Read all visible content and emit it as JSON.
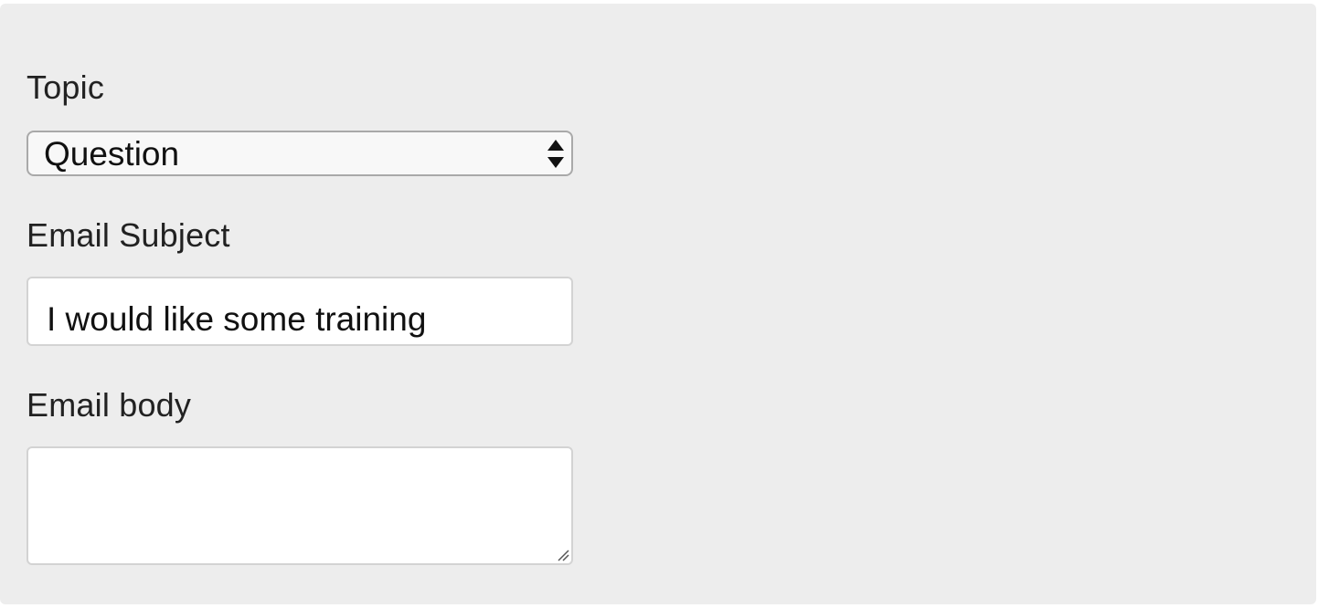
{
  "form": {
    "topic_label": "Topic",
    "topic_selected": "Question",
    "subject_label": "Email Subject",
    "subject_value": "I would like some training",
    "body_label": "Email body",
    "body_value": ""
  },
  "icons": {
    "select_arrows": "up-down-arrows-icon",
    "resize_grip": "resize-handle-icon"
  },
  "colors": {
    "panel_bg": "#ededed",
    "text": "#222222",
    "field_border": "#d3d3d3",
    "select_border": "#a9a9a9"
  }
}
